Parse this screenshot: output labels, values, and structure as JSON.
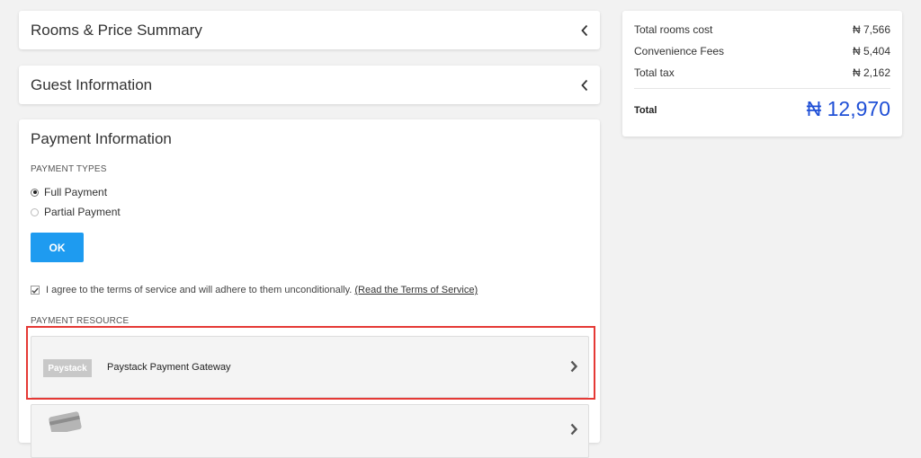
{
  "accordions": [
    {
      "title": "Rooms & Price Summary"
    },
    {
      "title": "Guest Information"
    }
  ],
  "payment": {
    "title": "Payment Information",
    "types_label": "PAYMENT TYPES",
    "options": [
      {
        "label": "Full Payment",
        "selected": true
      },
      {
        "label": "Partial Payment",
        "selected": false
      }
    ],
    "ok_label": "OK",
    "agree_text": "I agree to the terms of service and will adhere to them unconditionally.",
    "tos_link": "(Read the Terms of Service)",
    "agree_checked": true,
    "resource_label": "PAYMENT RESOURCE",
    "gateways": [
      {
        "logo_text": "Paystack",
        "name": "Paystack Payment Gateway",
        "icon": "paystack-logo"
      },
      {
        "logo_text": "",
        "name": "",
        "icon": "credit-card-icon"
      }
    ]
  },
  "summary": {
    "rows": [
      {
        "label": "Total rooms cost",
        "value": "₦ 7,566"
      },
      {
        "label": "Convenience Fees",
        "value": "₦ 5,404"
      },
      {
        "label": "Total tax",
        "value": "₦ 2,162"
      }
    ],
    "total_label": "Total",
    "total_value": "₦ 12,970"
  },
  "colors": {
    "accent": "#1e9bf0",
    "total": "#1f4fd6",
    "highlight": "#e53935"
  }
}
